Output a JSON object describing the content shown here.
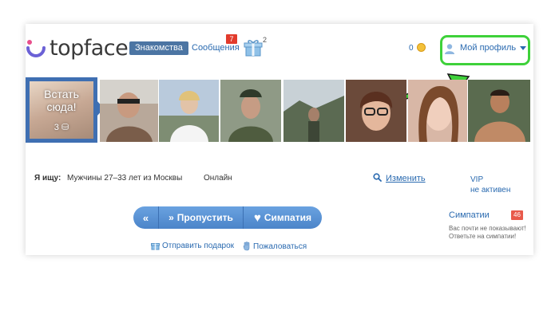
{
  "header": {
    "logo_text": "topface",
    "nav_dating": "Знакомства",
    "nav_messages": "Сообщения",
    "messages_badge": "7",
    "gifts_count": "2",
    "coins": "0",
    "profile_label": "Мой профиль"
  },
  "strip": {
    "cta_text": "Встать сюда!",
    "cta_count": "3"
  },
  "search": {
    "label": "Я ищу:",
    "value": "Мужчины  27–33 лет из Москвы",
    "online": "Онлайн",
    "change_link": "Изменить"
  },
  "vip": {
    "line1": "VIP",
    "line2": "не активен"
  },
  "actions": {
    "skip": "Пропустить",
    "like": "Симпатия",
    "send_gift": "Отправить подарок",
    "report": "Пожаловаться"
  },
  "sympathies": {
    "title": "Симпатии",
    "badge": "46",
    "text": "Вас почти не показывают! Ответьте на симпатии!"
  },
  "colors": {
    "brand_blue": "#4c75a3",
    "link_blue": "#2a6ab0",
    "badge_red": "#e23b2c",
    "highlight_green": "#3ed13a"
  }
}
